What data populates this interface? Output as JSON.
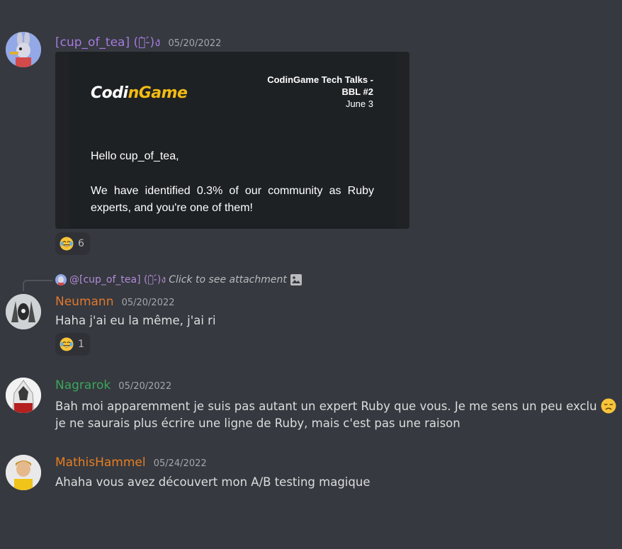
{
  "messages": [
    {
      "username": "[cup_of_tea] (ง̀-́)ง",
      "username_color": "#a67ae0",
      "timestamp": "05/20/2022",
      "embed": {
        "logo_prefix": "Codi",
        "logo_accent": "nGame",
        "event_title_line1": "CodinGame Tech Talks -",
        "event_title_line2": "BBL #2",
        "event_date": "June 3",
        "greeting": "Hello cup_of_tea,",
        "body": "We have identified 0.3% of our community as Ruby experts, and you're one of them!"
      },
      "reaction": {
        "emoji": "joy-emoji",
        "count": "6"
      }
    },
    {
      "reply": {
        "name": "@[cup_of_tea] (ง̀-́)ง",
        "text": "Click to see attachment",
        "icon": "image-icon"
      },
      "username": "Neumann",
      "username_color": "#e0782f",
      "timestamp": "05/20/2022",
      "content": "Haha j'ai eu la même, j'ai ri",
      "reaction": {
        "emoji": "joy-emoji",
        "count": "1"
      }
    },
    {
      "username": "Nagrarok",
      "username_color": "#3ba55c",
      "timestamp": "05/20/2022",
      "content_line1": "Bah moi apparemment je suis pas autant un expert Ruby que vous. Je me sens un peu exclu",
      "content_line2": "je ne saurais plus écrire une ligne de Ruby, mais c'est pas une raison"
    },
    {
      "username": "MathisHammel",
      "username_color": "#e67e22",
      "timestamp": "05/24/2022",
      "content": "Ahaha vous avez découvert mon A/B testing magique"
    }
  ]
}
